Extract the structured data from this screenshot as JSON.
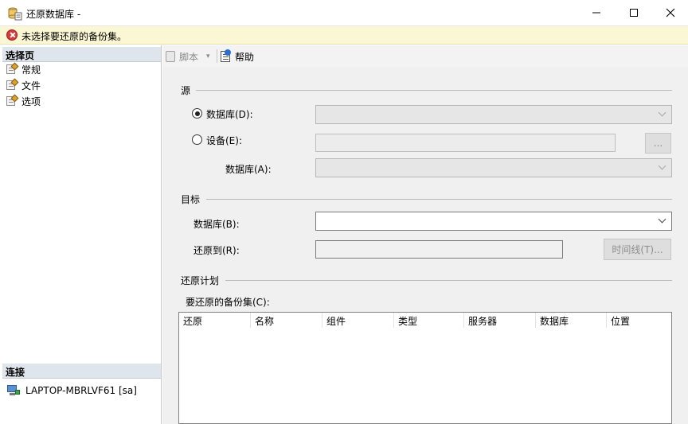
{
  "window": {
    "title": "还原数据库 -",
    "app_icon": "restore-database-icon",
    "controls": {
      "minimize": "—",
      "maximize": "☐",
      "close": "✕"
    }
  },
  "error_bar": {
    "message": "未选择要还原的备份集。",
    "icon": "error-icon",
    "background": "#fbf7d5"
  },
  "sidebar": {
    "select_page_header": "选择页",
    "items": [
      {
        "label": "常规",
        "icon": "page-wrench-icon"
      },
      {
        "label": "文件",
        "icon": "page-wrench-icon"
      },
      {
        "label": "选项",
        "icon": "page-wrench-icon"
      }
    ],
    "connection_header": "连接",
    "connection": {
      "label": "LAPTOP-MBRLVF61 [sa]",
      "icon": "server-connection-icon"
    }
  },
  "toolbar": {
    "script_label": "脚本",
    "script_caret": "▾",
    "help_label": "帮助"
  },
  "source": {
    "section_title": "源",
    "database_radio": {
      "label": "数据库(D):",
      "selected": true
    },
    "device_radio": {
      "label": "设备(E):",
      "selected": false
    },
    "device_browse_label": "...",
    "device_database_label": "数据库(A):"
  },
  "destination": {
    "section_title": "目标",
    "database_label": "数据库(B):",
    "restore_to_label": "还原到(R):",
    "timeline_button": "时间线(T)..."
  },
  "restore_plan": {
    "section_title": "还原计划",
    "backup_sets_label": "要还原的备份集(C):",
    "columns": [
      "还原",
      "名称",
      "组件",
      "类型",
      "服务器",
      "数据库",
      "位置"
    ]
  }
}
